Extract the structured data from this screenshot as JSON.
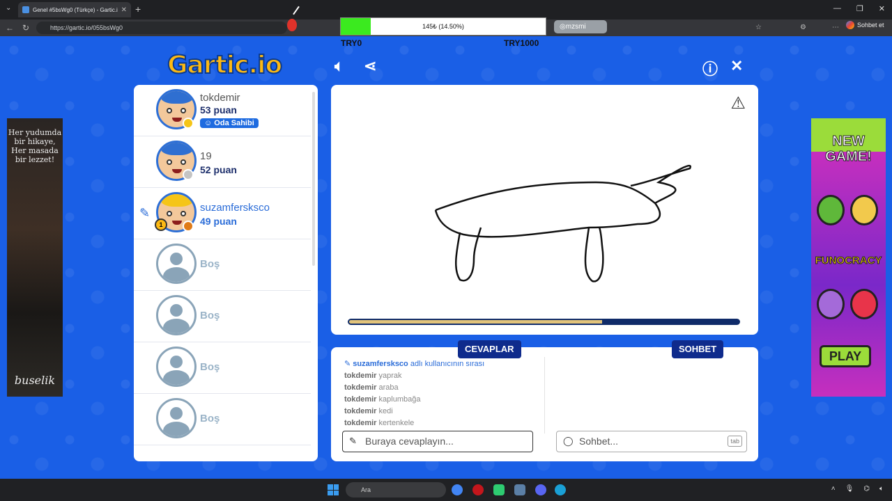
{
  "browser": {
    "tab_title": "Genel #5bsWg0 (Türkçe) - Gartic.io",
    "url": "https://gartic.io/055bsWg0",
    "new_tab_label": "+",
    "ig_handle": "mzsmi",
    "sohbet_label": "Sohbet et"
  },
  "donation": {
    "progress_text": "145₺ (14.50%)",
    "progress_percent": 14.5,
    "left_label": "TRY0",
    "right_label": "TRY1000"
  },
  "game": {
    "logo": "Gartic.io",
    "players": [
      {
        "name": "tokdemir",
        "points": "53 puan",
        "badge": "Oda Sahibi",
        "hair": "#2f6fd1",
        "dot": "#f5c518"
      },
      {
        "name": "19",
        "points": "52 puan",
        "hair": "#2f6fd1",
        "dot": "#c4c4c4"
      },
      {
        "name": "suzamfersksco",
        "points": "49 puan",
        "hair": "#f5c518",
        "dot": "#e07b18",
        "trophy": "1"
      },
      {
        "name": "Boş"
      },
      {
        "name": "Boş"
      },
      {
        "name": "Boş"
      },
      {
        "name": "Boş"
      }
    ],
    "timer_percent": 65,
    "tabs": {
      "answers": "CEVAPLAR",
      "chat": "SOHBET"
    },
    "answers": [
      {
        "user": "suzamfersksco",
        "text": "adlı kullanıcının sırası"
      },
      {
        "user": "tokdemir",
        "text": "yaprak"
      },
      {
        "user": "tokdemir",
        "text": "araba"
      },
      {
        "user": "tokdemir",
        "text": "kaplumbağa"
      },
      {
        "user": "tokdemir",
        "text": "kedi"
      },
      {
        "user": "tokdemir",
        "text": "kertenkele"
      }
    ],
    "answer_placeholder": "Buraya cevaplayın...",
    "chat_placeholder": "Sohbet...",
    "tab_key": "tab"
  },
  "ads": {
    "left_text": "Her yudumda bir hikaye, Her masada bir lezzet!",
    "left_brand": "buselik",
    "right_title": "NEW GAME!",
    "right_brand": "FUNOCRACY",
    "right_play": "PLAY"
  },
  "taskbar": {
    "search": "Ara"
  }
}
